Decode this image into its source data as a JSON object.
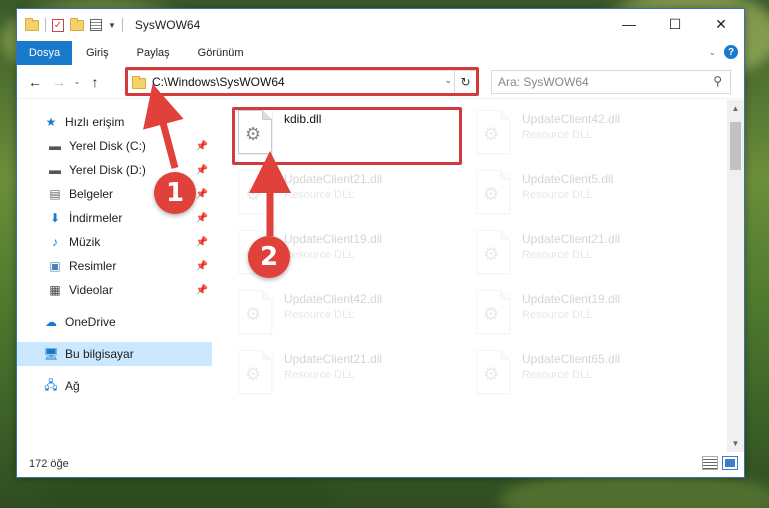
{
  "title": "SysWOW64",
  "window_controls": {
    "minimize": "—",
    "maximize": "☐",
    "close": "✕"
  },
  "ribbon": {
    "tabs": [
      "Dosya",
      "Giriş",
      "Paylaş",
      "Görünüm"
    ],
    "help": "?",
    "collapse": "⌄"
  },
  "nav": {
    "back": "←",
    "forward": "→",
    "recent": "⌄",
    "up": "↑",
    "address": "C:\\Windows\\SysWOW64",
    "address_dropdown": "⌄",
    "refresh": "↻",
    "search_placeholder": "Ara: SysWOW64",
    "search_icon": "⚲"
  },
  "sidebar": {
    "quick_access": "Hızlı erişim",
    "items": [
      {
        "label": "Yerel Disk (C:)",
        "icon": "drive-icon",
        "pinned": true
      },
      {
        "label": "Yerel Disk (D:)",
        "icon": "drive-icon",
        "pinned": true
      },
      {
        "label": "Belgeler",
        "icon": "documents-icon",
        "pinned": true
      },
      {
        "label": "İndirmeler",
        "icon": "downloads-icon",
        "pinned": true
      },
      {
        "label": "Müzik",
        "icon": "music-icon",
        "pinned": true
      },
      {
        "label": "Resimler",
        "icon": "pictures-icon",
        "pinned": true
      },
      {
        "label": "Videolar",
        "icon": "videos-icon",
        "pinned": true
      }
    ],
    "onedrive": "OneDrive",
    "this_pc": "Bu bilgisayar",
    "network": "Ağ"
  },
  "files": [
    {
      "name": "kdib.dll",
      "type": "",
      "highlighted": true
    },
    {
      "name": "UpdateClient42.dll",
      "type": "Resource DLL"
    },
    {
      "name": "UpdateClient21.dll",
      "type": "Resource DLL"
    },
    {
      "name": "UpdateClient5.dll",
      "type": "Resource DLL"
    },
    {
      "name": "UpdateClient19.dll",
      "type": "Resource DLL"
    },
    {
      "name": "UpdateClient21.dll",
      "type": "Resource DLL"
    },
    {
      "name": "UpdateClient42.dll",
      "type": "Resource DLL"
    },
    {
      "name": "UpdateClient19.dll",
      "type": "Resource DLL"
    },
    {
      "name": "UpdateClient21.dll",
      "type": "Resource DLL"
    },
    {
      "name": "UpdateClient65.dll",
      "type": "Resource DLL"
    }
  ],
  "status": {
    "count": "172 öğe"
  },
  "markers": [
    "1",
    "2"
  ],
  "colors": {
    "accent": "#1979ca",
    "highlight": "#d33a3a",
    "selected": "#cce8ff"
  }
}
